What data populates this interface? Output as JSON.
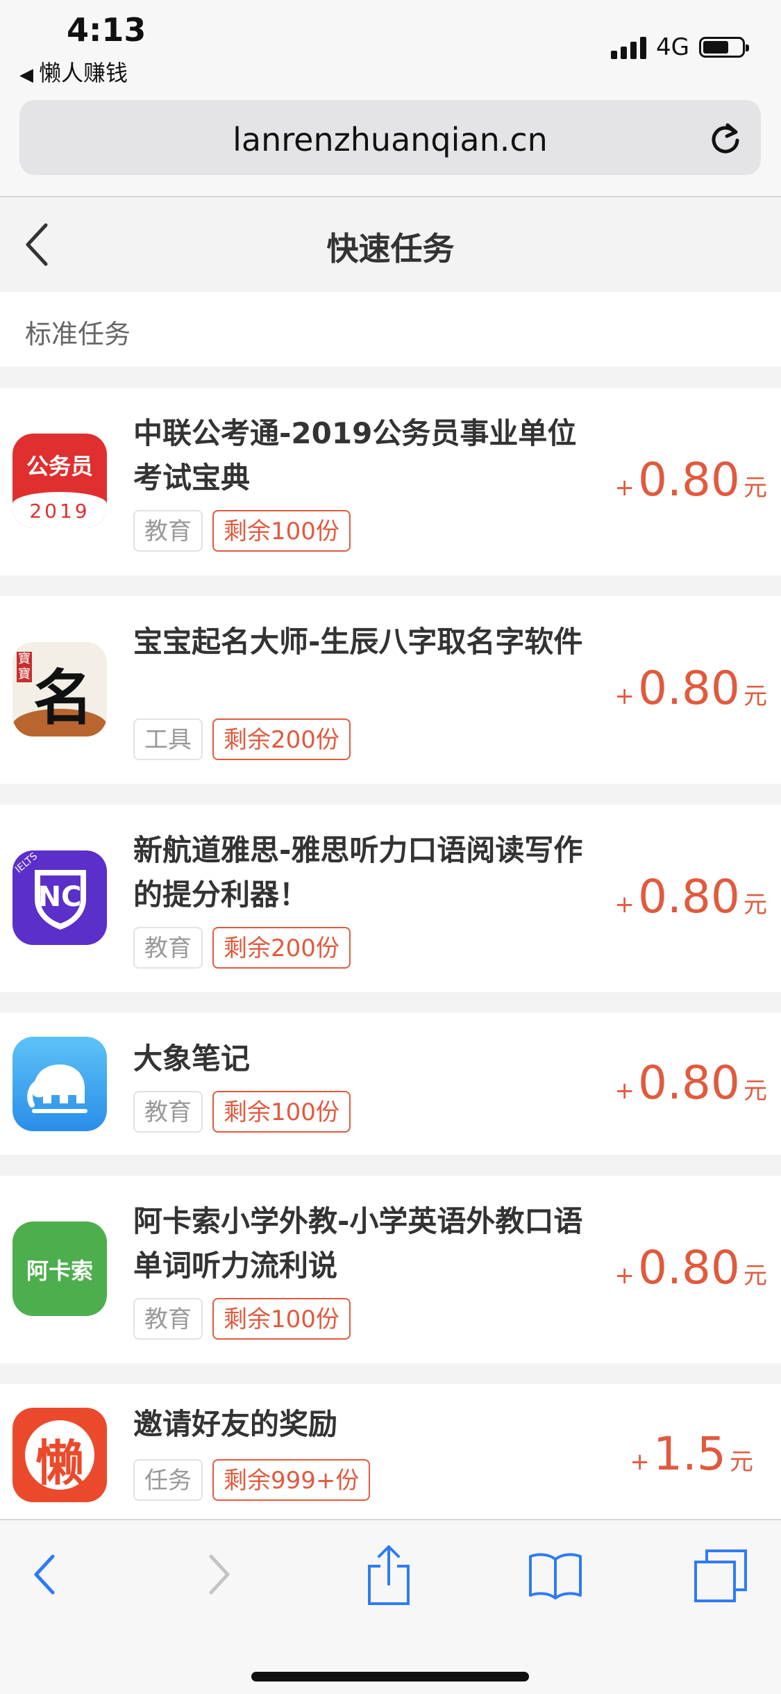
{
  "status": {
    "time": "4:13",
    "back_app": "懒人赚钱",
    "network": "4G"
  },
  "browser": {
    "url": "lanrenzhuanqian.cn"
  },
  "page": {
    "title": "快速任务",
    "section": "标准任务"
  },
  "tasks": [
    {
      "name": "中联公考通-2019公务员事业单位考试宝典",
      "category": "教育",
      "remaining": "剩余100份",
      "plus": "+",
      "amount": "0.80",
      "unit": "元",
      "icon_label": "公务员",
      "icon_sub": "2019"
    },
    {
      "name": "宝宝起名大师-生辰八字取名字软件",
      "category": "工具",
      "remaining": "剩余200份",
      "plus": "+",
      "amount": "0.80",
      "unit": "元",
      "icon_label": "名",
      "icon_sub": "寶寶"
    },
    {
      "name": "新航道雅思-雅思听力口语阅读写作的提分利器！",
      "category": "教育",
      "remaining": "剩余200份",
      "plus": "+",
      "amount": "0.80",
      "unit": "元",
      "icon_label": "NC",
      "icon_sub": "IELTS"
    },
    {
      "name": "大象笔记",
      "category": "教育",
      "remaining": "剩余100份",
      "plus": "+",
      "amount": "0.80",
      "unit": "元"
    },
    {
      "name": "阿卡索小学外教-小学英语外教口语单词听力流利说",
      "category": "教育",
      "remaining": "剩余100份",
      "plus": "+",
      "amount": "0.80",
      "unit": "元",
      "icon_label": "阿卡索"
    },
    {
      "name": "邀请好友的奖励",
      "category": "任务",
      "remaining": "剩余999+份",
      "plus": "+",
      "amount": "1.5",
      "unit": "元",
      "icon_label": "懒"
    }
  ],
  "colors": {
    "accent": "#e05a3e",
    "ios_blue": "#2f7bf5"
  }
}
